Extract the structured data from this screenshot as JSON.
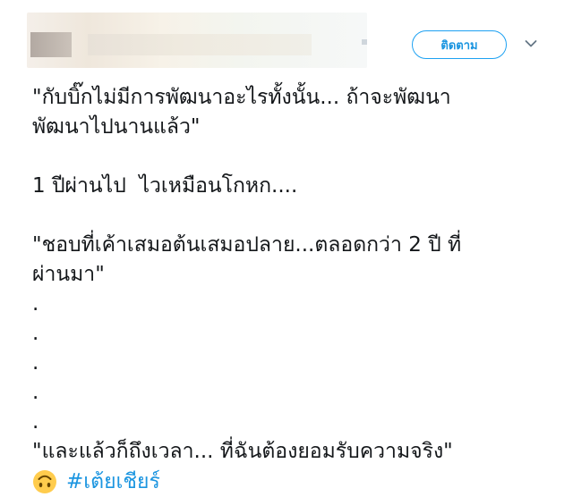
{
  "header": {
    "follow_label": "ติดตาม",
    "more_icon": "chevron-down-icon",
    "avatar": "blurred-avatar",
    "username": "blurred-username"
  },
  "tweet": {
    "lines": [
      "\"กับบิ๊กไม่มีการพัฒนาอะไรทั้งนั้น... ถ้าจะพัฒนา",
      "พัฒนาไปนานแล้ว\"",
      "",
      "1 ปีผ่านไป  ไวเหมือนโกหก....",
      "",
      "\"ชอบที่เค้าเสมอต้นเสมอปลาย...ตลอดกว่า 2 ปี ที่",
      "ผ่านมา\"",
      ".",
      ".",
      ".",
      ".",
      ".",
      "\"และแล้วก็ถึงเวลา... ที่ฉันต้องยอมรับความจริง\""
    ],
    "emoji": "upside-down-face-emoji",
    "hashtag": "#เต้ยเชียร์"
  },
  "colors": {
    "accent": "#1da1f2",
    "link": "#1b95e0",
    "text": "#14171a",
    "chevron": "#657786",
    "emoji_yellow": "#ffcc4d"
  }
}
